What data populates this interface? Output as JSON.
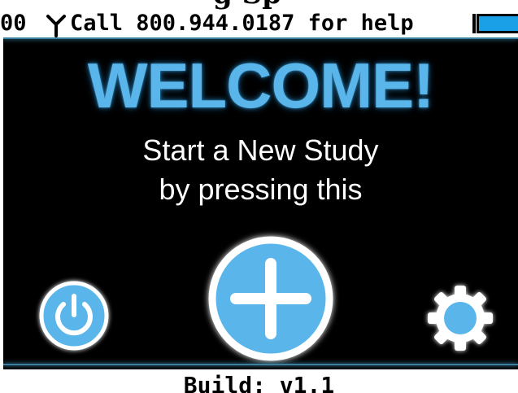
{
  "header": {
    "partial_title": "g Sp",
    "signal_text": "00",
    "help_text": "Call 800.944.0187 for help",
    "antenna_icon": "antenna-signal-icon",
    "battery_icon": "battery-full-icon"
  },
  "main": {
    "welcome_title": "WELCOME!",
    "instruction_line_1": "Start a New Study",
    "instruction_line_2": "by pressing this"
  },
  "buttons": {
    "power_icon": "power-icon",
    "add_icon": "plus-icon",
    "settings_icon": "gear-icon"
  },
  "footer": {
    "build_label": "Build: v1.1"
  },
  "colors": {
    "accent": "#5ab6ea",
    "background": "#000000",
    "text": "#ffffff"
  }
}
